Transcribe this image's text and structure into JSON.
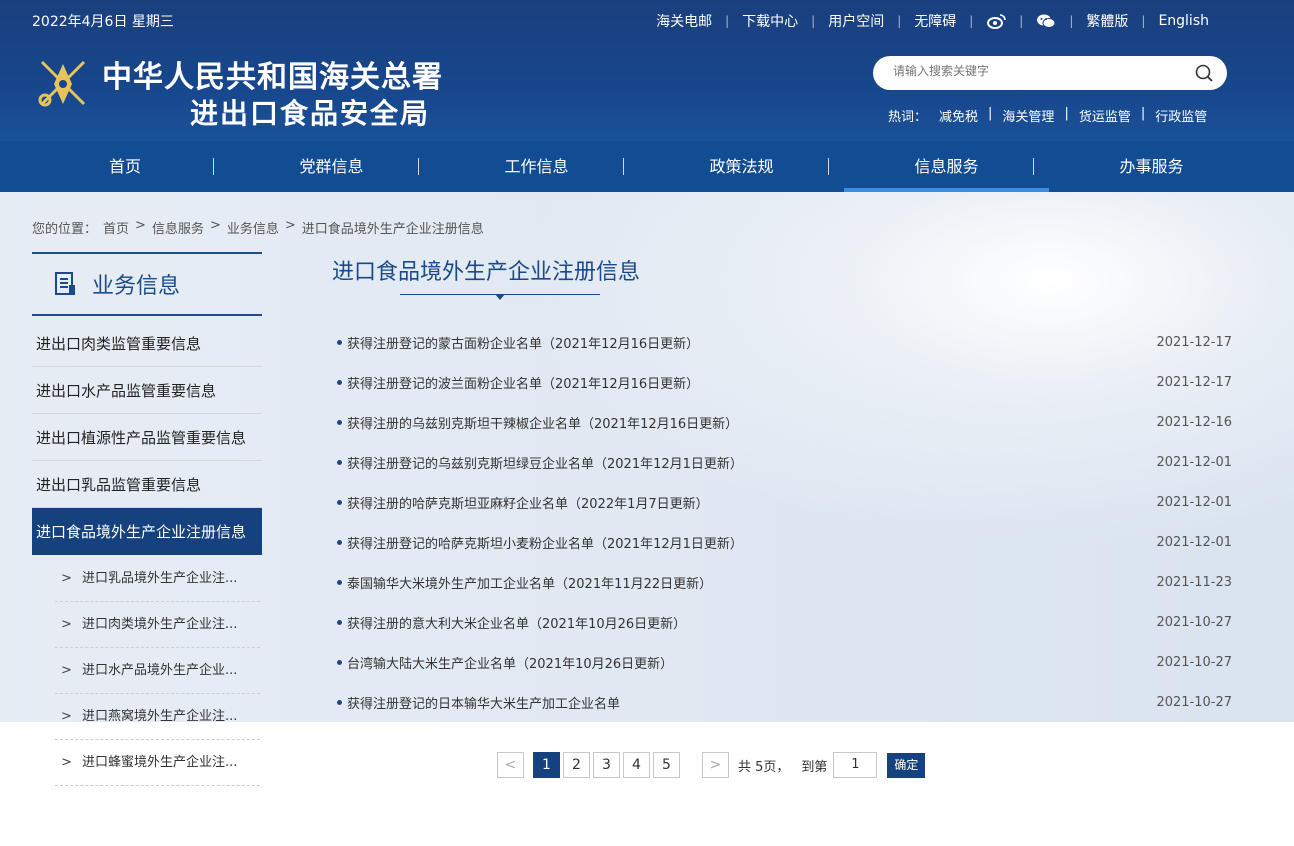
{
  "header": {
    "date": "2022年4月6日 星期三",
    "top_links": [
      "海关电邮",
      "下载中心",
      "用户空间",
      "无障碍"
    ],
    "lang_traditional": "繁體版",
    "lang_english": "English",
    "title_line1": "中华人民共和国海关总署",
    "title_line2": "进出口食品安全局",
    "search_placeholder": "请输入搜索关键字",
    "hot_label": "热词：",
    "hot_words": [
      "减免税",
      "海关管理",
      "货运监管",
      "行政监管"
    ]
  },
  "nav": {
    "items": [
      "首页",
      "党群信息",
      "工作信息",
      "政策法规",
      "信息服务",
      "办事服务"
    ],
    "active_index": 4
  },
  "breadcrumb": [
    "您的位置：",
    "首页",
    ">",
    "信息服务",
    ">",
    "业务信息",
    ">",
    "进口食品境外生产企业注册信息"
  ],
  "sidebar": {
    "title": "业务信息",
    "items": [
      "进出口肉类监管重要信息",
      "进出口水产品监管重要信息",
      "进出口植源性产品监管重要信息",
      "进出口乳品监管重要信息",
      "进口食品境外生产企业注册信息"
    ],
    "active_index": 4,
    "sub_arrow": ">",
    "sub_items": [
      "进口乳品境外生产企业注...",
      "进口肉类境外生产企业注...",
      "进口水产品境外生产企业...",
      "进口燕窝境外生产企业注...",
      "进口蜂蜜境外生产企业注..."
    ]
  },
  "main": {
    "title": "进口食品境外生产企业注册信息",
    "rows": [
      {
        "title": "获得注册登记的蒙古面粉企业名单（2021年12月16日更新）",
        "date": "2021-12-17"
      },
      {
        "title": "获得注册登记的波兰面粉企业名单（2021年12月16日更新）",
        "date": "2021-12-17"
      },
      {
        "title": "获得注册的乌兹别克斯坦干辣椒企业名单（2021年12月16日更新）",
        "date": "2021-12-16"
      },
      {
        "title": "获得注册登记的乌兹别克斯坦绿豆企业名单（2021年12月1日更新）",
        "date": "2021-12-01"
      },
      {
        "title": "获得注册的哈萨克斯坦亚麻籽企业名单（2022年1月7日更新）",
        "date": "2021-12-01"
      },
      {
        "title": "获得注册登记的哈萨克斯坦小麦粉企业名单（2021年12月1日更新）",
        "date": "2021-12-01"
      },
      {
        "title": "泰国输华大米境外生产加工企业名单（2021年11月22日更新）",
        "date": "2021-11-23"
      },
      {
        "title": "获得注册的意大利大米企业名单（2021年10月26日更新）",
        "date": "2021-10-27"
      },
      {
        "title": "台湾输大陆大米生产企业名单（2021年10月26日更新）",
        "date": "2021-10-27"
      },
      {
        "title": "获得注册登记的日本输华大米生产加工企业名单",
        "date": "2021-10-27"
      }
    ]
  },
  "pager": {
    "prev": "<",
    "next": ">",
    "pages": [
      "1",
      "2",
      "3",
      "4",
      "5"
    ],
    "current": "1",
    "total_text": "共 5页，",
    "goto_label": "到第",
    "goto_value": "1",
    "confirm": "确定"
  }
}
